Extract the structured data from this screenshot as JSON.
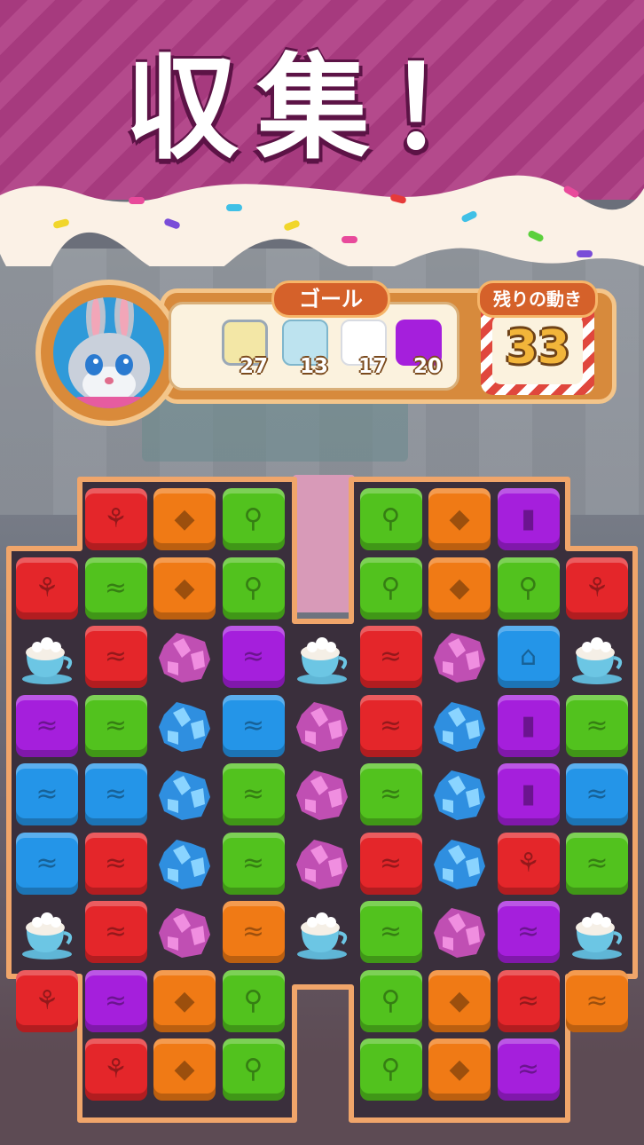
{
  "banner": {
    "title": "収集！"
  },
  "hud": {
    "goal_label": "ゴール",
    "moves_label": "残りの動き",
    "moves_value": "33",
    "goals": [
      {
        "icon": "milk-jar-icon",
        "count": "27"
      },
      {
        "icon": "ice-crystal-icon",
        "count": "13"
      },
      {
        "icon": "sugar-cube-icon",
        "count": "17"
      },
      {
        "icon": "purple-cube-icon",
        "count": "20"
      }
    ]
  },
  "colors": {
    "red": "#e4262a",
    "orange": "#f07a15",
    "green": "#52c21e",
    "purple": "#a51fdc",
    "blue": "#2495e8"
  },
  "board": {
    "columns": 9,
    "rows": 9,
    "cells": [
      [
        null,
        "red-cherry",
        "orange-candy",
        "green-lolly",
        null,
        "green-lolly",
        "orange-candy",
        "purple-popsicle",
        null
      ],
      [
        "red-cherry",
        "green-wave",
        "orange-candy",
        "green-lolly",
        null,
        "green-lolly",
        "orange-candy",
        "green-lolly",
        "red-cherry"
      ],
      [
        "cocoa-cup",
        "red-wave",
        "pink-crystal",
        "purple-wave",
        "cocoa-cup",
        "red-wave",
        "pink-crystal",
        "blue-cupcake",
        "cocoa-cup"
      ],
      [
        "purple-wave",
        "green-wave",
        "blue-crystal",
        "blue-wave",
        "pink-crystal",
        "red-wave",
        "blue-crystal",
        "purple-popsicle",
        "green-wave"
      ],
      [
        "blue-wave",
        "blue-wave",
        "blue-crystal",
        "green-wave",
        "pink-crystal",
        "green-wave",
        "blue-crystal",
        "purple-popsicle",
        "blue-wave"
      ],
      [
        "blue-wave",
        "red-wave",
        "blue-crystal",
        "green-wave",
        "pink-crystal",
        "red-wave",
        "blue-crystal",
        "red-cherry",
        "green-wave"
      ],
      [
        "cocoa-cup",
        "red-wave",
        "pink-crystal",
        "orange-wave",
        "cocoa-cup",
        "green-wave",
        "pink-crystal",
        "purple-wave",
        "cocoa-cup"
      ],
      [
        "red-cherry",
        "purple-wave",
        "orange-candy",
        "green-lolly",
        null,
        "green-lolly",
        "orange-candy",
        "red-wave",
        "orange-wave"
      ],
      [
        null,
        "red-cherry",
        "orange-candy",
        "green-lolly",
        null,
        "green-lolly",
        "orange-candy",
        "purple-wave",
        null
      ]
    ]
  }
}
